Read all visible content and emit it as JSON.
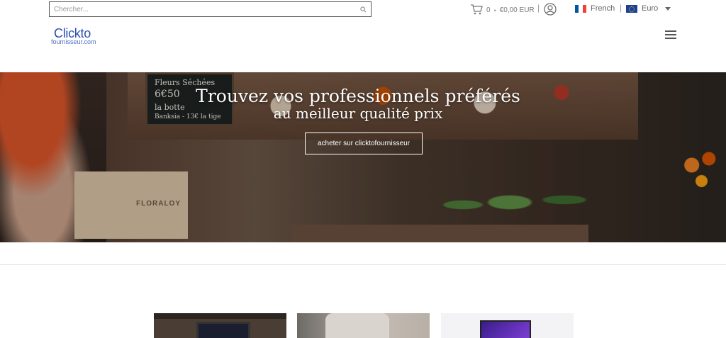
{
  "header": {
    "search": {
      "placeholder": "Chercher..."
    },
    "cart": {
      "count": "0",
      "separator": "•",
      "total": "€0,00 EUR"
    },
    "divider": "|",
    "language": {
      "label": "French"
    },
    "currency": {
      "label": "Euro"
    }
  },
  "logo": {
    "line1": "Clickto",
    "line2": "fournisseur.com"
  },
  "hero": {
    "title": "Trouvez vos professionnels préférés",
    "subtitle": "au meilleur qualité prix",
    "button_label": "acheter sur clicktofournisseur",
    "board_lines": [
      "Fleurs Séchées",
      "6€50",
      "la botte",
      "Banksia - 13€ la tige"
    ],
    "box_label": "FLORALOY"
  },
  "colors": {
    "logo": "#2d4fb0",
    "hero_text": "#ffffff",
    "flag_blue": "#0055a4",
    "flag_red": "#ef4135"
  }
}
